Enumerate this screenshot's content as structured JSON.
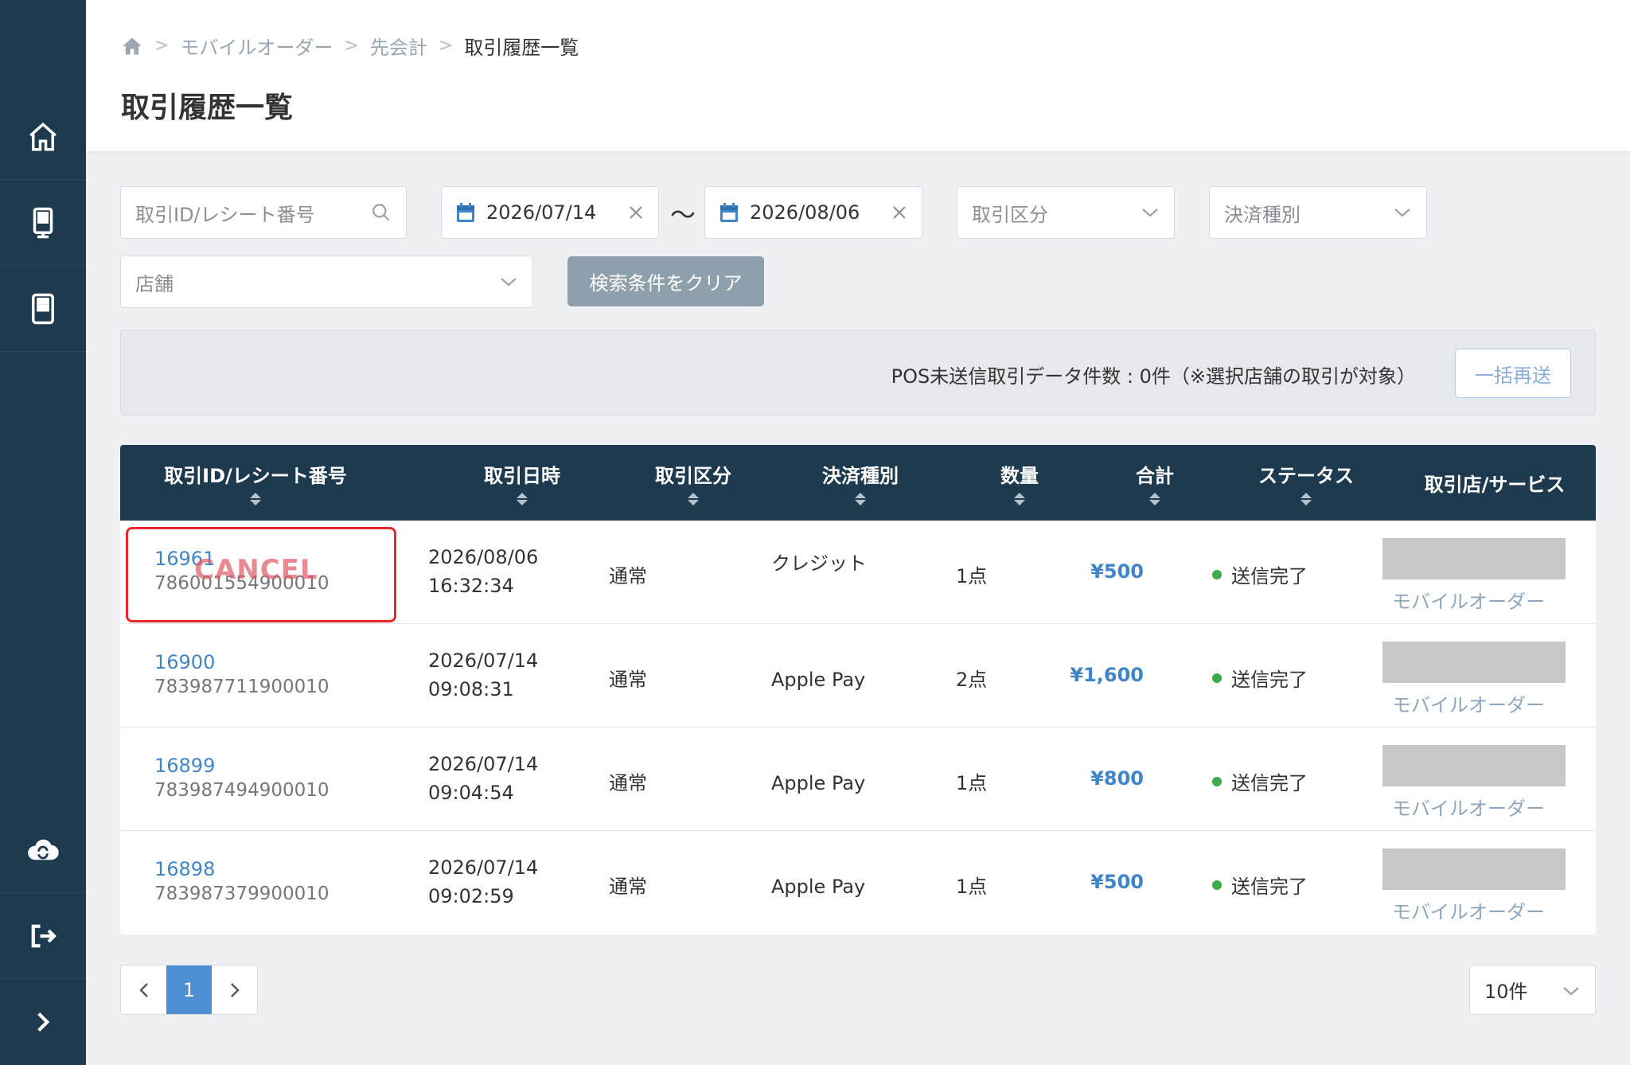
{
  "breadcrumb": {
    "items": [
      "モバイルオーダー",
      "先会計"
    ],
    "current": "取引履歴一覧"
  },
  "page_title": "取引履歴一覧",
  "filters": {
    "search_placeholder": "取引ID/レシート番号",
    "date_from": "2026/07/14",
    "date_to": "2026/08/06",
    "range_sep": "〜",
    "type_placeholder": "取引区分",
    "payment_placeholder": "決済種別",
    "store_placeholder": "店舗",
    "clear_label": "検索条件をクリア"
  },
  "pos": {
    "text": "POS未送信取引データ件数 : 0件（※選択店舗の取引が対象）",
    "resend_label": "一括再送"
  },
  "table": {
    "headers": {
      "tid": "取引ID/レシート番号",
      "datetime": "取引日時",
      "type": "取引区分",
      "payment": "決済種別",
      "qty": "数量",
      "total": "合計",
      "status": "ステータス",
      "store": "取引店/サービス"
    },
    "cancel_label": "CANCEL",
    "rows": [
      {
        "id": "16961",
        "receipt": "786001554900010",
        "date": "2026/08/06",
        "time": "16:32:34",
        "type": "通常",
        "payment": "クレジット",
        "qty": "1点",
        "total": "¥500",
        "status": "送信完了",
        "service": "モバイルオーダー"
      },
      {
        "id": "16900",
        "receipt": "783987711900010",
        "date": "2026/07/14",
        "time": "09:08:31",
        "type": "通常",
        "payment": "Apple Pay",
        "qty": "2点",
        "total": "¥1,600",
        "status": "送信完了",
        "service": "モバイルオーダー"
      },
      {
        "id": "16899",
        "receipt": "783987494900010",
        "date": "2026/07/14",
        "time": "09:04:54",
        "type": "通常",
        "payment": "Apple Pay",
        "qty": "1点",
        "total": "¥800",
        "status": "送信完了",
        "service": "モバイルオーダー"
      },
      {
        "id": "16898",
        "receipt": "783987379900010",
        "date": "2026/07/14",
        "time": "09:02:59",
        "type": "通常",
        "payment": "Apple Pay",
        "qty": "1点",
        "total": "¥500",
        "status": "送信完了",
        "service": "モバイルオーダー"
      }
    ]
  },
  "pagination": {
    "current": "1",
    "per_page": "10件"
  },
  "colors": {
    "sidebar": "#1d3a4f",
    "accent": "#3f85c9",
    "status_ok": "#3dab4a",
    "highlight": "#e8282a"
  },
  "icons": [
    "home-icon",
    "kiosk-icon",
    "tablet-icon",
    "cloud-sync-icon",
    "logout-icon",
    "expand-icon"
  ]
}
